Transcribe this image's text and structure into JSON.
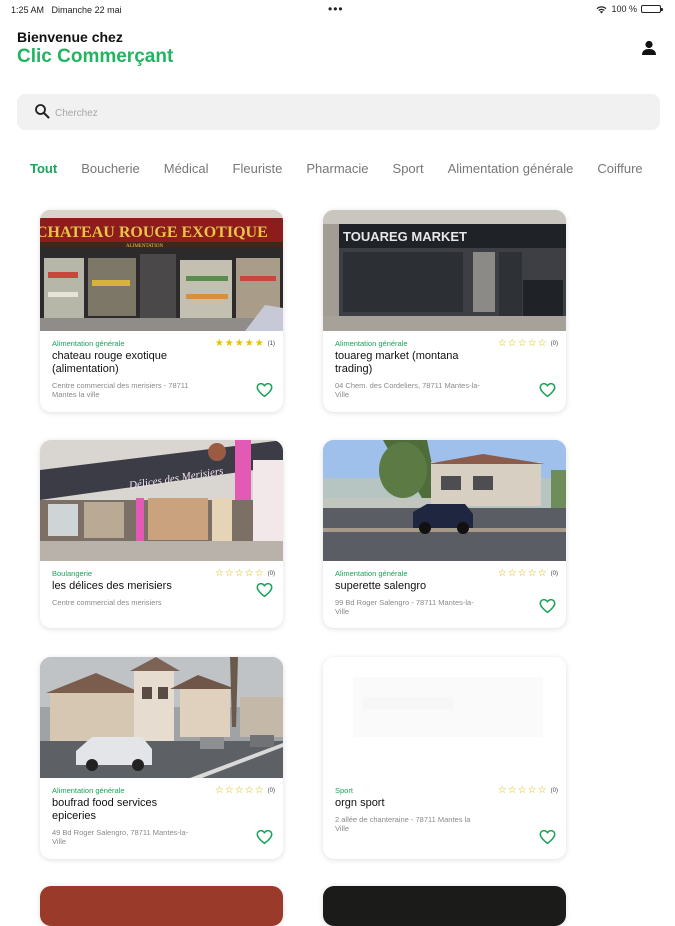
{
  "status_bar": {
    "time": "1:25 AM",
    "date": "Dimanche 22 mai",
    "dots": "•••",
    "battery": "100 %"
  },
  "header": {
    "welcome": "Bienvenue chez",
    "brand": "Clic Commerçant",
    "user_icon": "person-icon"
  },
  "search": {
    "placeholder": "Cherchez",
    "icon": "search-icon"
  },
  "tabs": [
    "Tout",
    "Boucherie",
    "Médical",
    "Fleuriste",
    "Pharmacie",
    "Sport",
    "Alimentation générale",
    "Coiffure"
  ],
  "active_tab": "Tout",
  "colors": {
    "accent": "#1aa35a",
    "brand": "#22b560",
    "star": "#e8c100"
  },
  "shops": [
    {
      "category": "Alimentation générale",
      "name": "chateau rouge exotique (alimentation)",
      "address": "Centre commercial des merisiers - 78711 Mantes la ville",
      "rating": 5,
      "count": "(1)",
      "sign": "CHATEAU ROUGE EXOTIQUE",
      "sign_sub": "ALIMENTATION"
    },
    {
      "category": "Alimentation générale",
      "name": "touareg market (montana trading)",
      "address": "04 Chem. des Cordeliers, 78711 Mantes-la-Ville",
      "rating": 0,
      "count": "(0)",
      "sign": "TOUAREG MARKET",
      "sign_sub": ""
    },
    {
      "category": "Boulangerie",
      "name": "les délices des merisiers",
      "address": "Centre commercial des merisiers",
      "rating": 0,
      "count": "(0)",
      "sign": "Délices des Merisiers",
      "sign_sub": ""
    },
    {
      "category": "Alimentation générale",
      "name": "superette salengro",
      "address": "99 Bd Roger Salengro - 78711 Mantes-la-Ville",
      "rating": 0,
      "count": "(0)",
      "sign": "",
      "sign_sub": ""
    },
    {
      "category": "Alimentation générale",
      "name": "boufrad food services epiceries",
      "address": "49 Bd Roger Salengro, 78711 Mantes-la-Ville",
      "rating": 0,
      "count": "(0)",
      "sign": "",
      "sign_sub": ""
    },
    {
      "category": "Sport",
      "name": "orgn sport",
      "address": "2 allée de chanteraine - 78711 Mantes la Ville",
      "rating": 0,
      "count": "(0)",
      "sign": "",
      "sign_sub": ""
    }
  ]
}
